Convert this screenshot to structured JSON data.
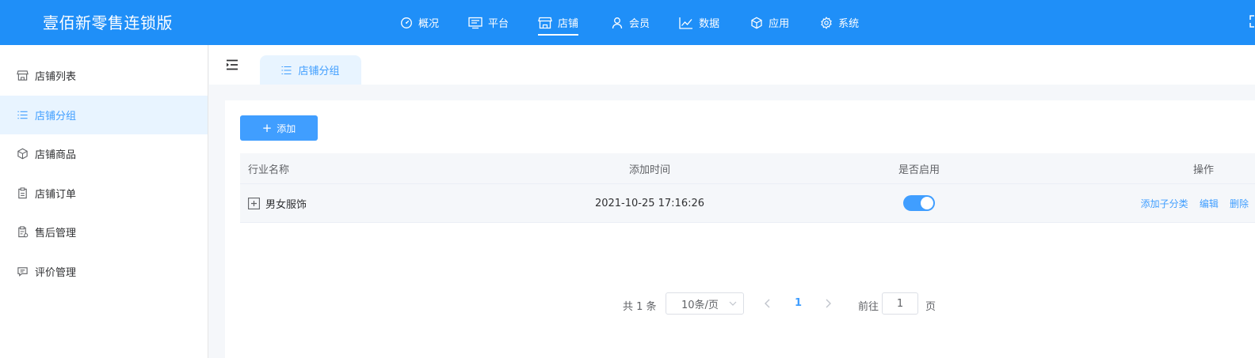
{
  "app": {
    "brand": "壹佰新零售连锁版"
  },
  "topnav": [
    {
      "label": "概况",
      "icon": "dashboard-icon"
    },
    {
      "label": "平台",
      "icon": "monitor-icon"
    },
    {
      "label": "店铺",
      "icon": "store-icon",
      "active": true
    },
    {
      "label": "会员",
      "icon": "user-icon"
    },
    {
      "label": "数据",
      "icon": "line-chart-icon"
    },
    {
      "label": "应用",
      "icon": "box-icon"
    },
    {
      "label": "系统",
      "icon": "gear-icon"
    }
  ],
  "sidebar": {
    "items": [
      {
        "label": "店铺列表",
        "icon": "store-icon"
      },
      {
        "label": "店铺分组",
        "icon": "list-icon",
        "active": true
      },
      {
        "label": "店铺商品",
        "icon": "box-icon"
      },
      {
        "label": "店铺订单",
        "icon": "clipboard-icon"
      },
      {
        "label": "售后管理",
        "icon": "after-sale-icon"
      },
      {
        "label": "评价管理",
        "icon": "comment-icon"
      }
    ]
  },
  "tabs": {
    "active_label": "店铺分组"
  },
  "toolbar": {
    "add_label": "添加"
  },
  "table": {
    "headers": [
      "行业名称",
      "添加时间",
      "是否启用",
      "操作"
    ],
    "rows": [
      {
        "name": "男女服饰",
        "time": "2021-10-25 17:16:26",
        "enabled": true,
        "actions": [
          "添加子分类",
          "编辑",
          "删除"
        ]
      }
    ]
  },
  "pagination": {
    "total_text": "共 1 条",
    "page_size": "10条/页",
    "current_page": "1",
    "goto_label": "前往",
    "goto_value": "1",
    "page_suffix": "页"
  },
  "colors": {
    "header_bg": "#1f8ff8",
    "accent": "#409eff",
    "active_bg": "#e8f4ff"
  }
}
